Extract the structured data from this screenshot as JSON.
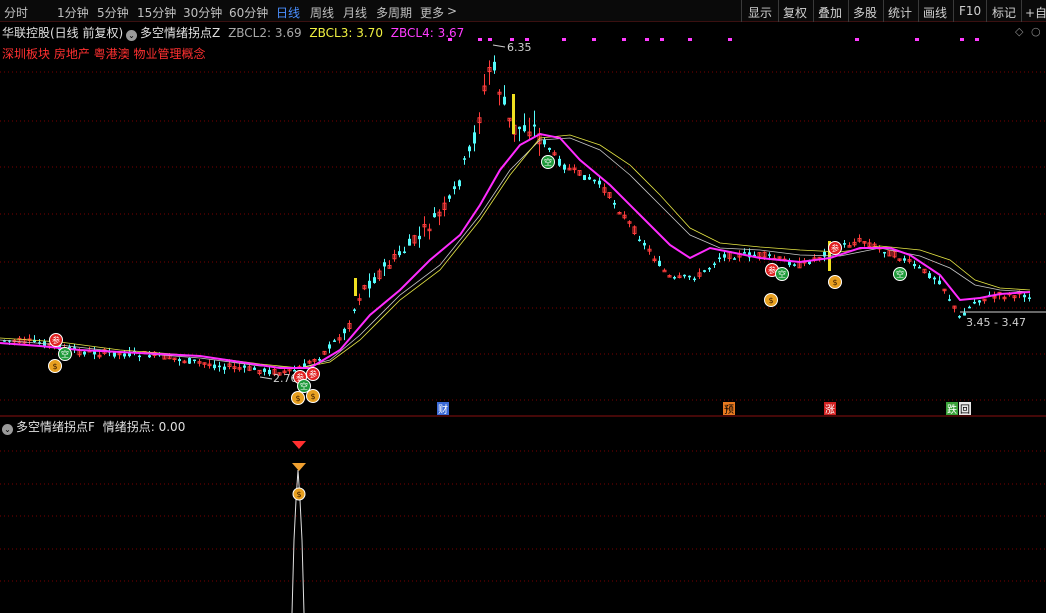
{
  "toolbar": {
    "timeframes": [
      "分时",
      "1分钟",
      "5分钟",
      "15分钟",
      "30分钟",
      "60分钟",
      "日线",
      "周线",
      "月线",
      "多周期",
      "更多"
    ],
    "active_timeframe": "日线",
    "right_buttons": [
      "显示",
      "复权",
      "叠加",
      "多股",
      "统计",
      "画线",
      "F10",
      "标记",
      "+自选"
    ]
  },
  "stock": {
    "title": "华联控股(日线 前复权)",
    "sectors": "深圳板块 房地产 粤港澳 物业管理概念"
  },
  "main_indicator": {
    "name": "多空情绪拐点Z",
    "zbcl2_label": "ZBCL2:",
    "zbcl2_value": "3.69",
    "zbcl3_label": "ZBCL3:",
    "zbcl3_value": "3.70",
    "zbcl4_label": "ZBCL4:",
    "zbcl4_value": "3.67"
  },
  "price_labels": {
    "high": "6.35",
    "low": "2.76",
    "range": "3.45 - 3.47"
  },
  "event_markers": [
    "财",
    "预",
    "涨",
    "跌",
    "回"
  ],
  "sub_indicator": {
    "name": "多空情绪拐点F",
    "value_label": "情绪拐点:",
    "value": "0.00"
  },
  "signal_icons": {
    "buy": "参",
    "empty": "空",
    "money": "$"
  },
  "colors": {
    "up": "#ff3c3c",
    "down": "#54fcfc",
    "ma_magenta": "#ff2bff",
    "ma_yellow": "#e8e845",
    "ma_white": "#c8c8c8",
    "grid": "#7a0000",
    "active_tab": "#4a8fff"
  }
}
